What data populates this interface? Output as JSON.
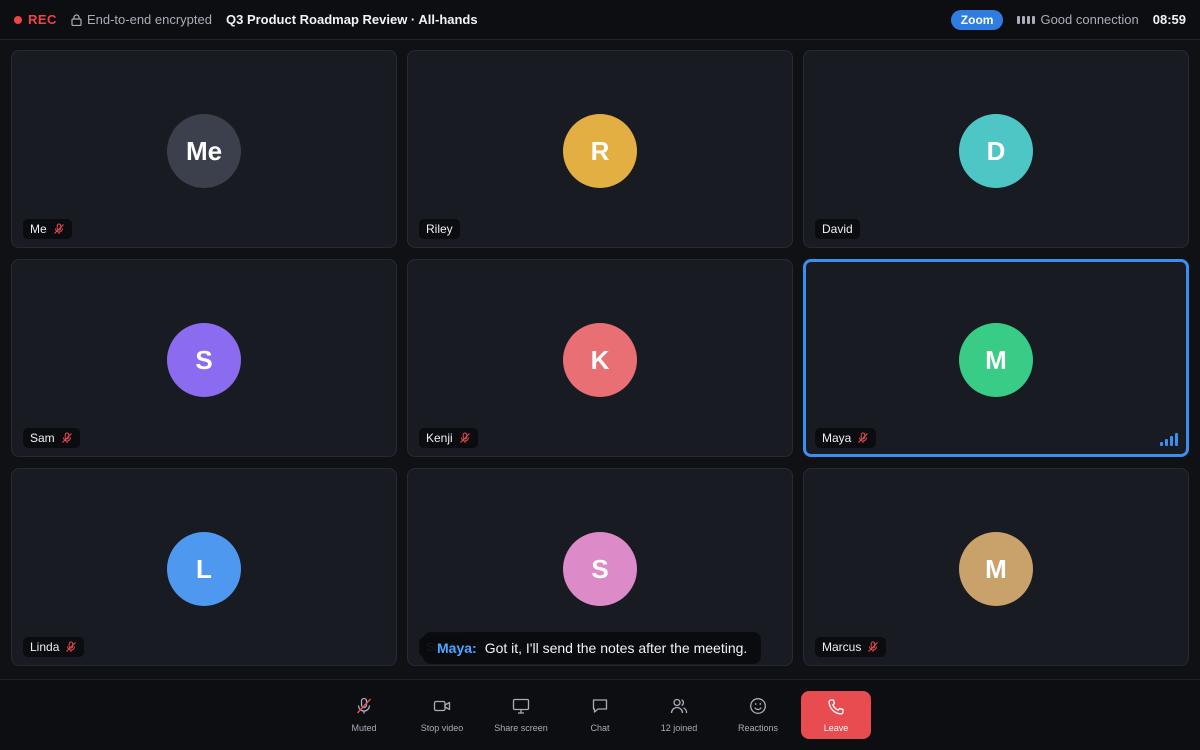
{
  "topbar": {
    "rec_label": "REC",
    "encryption_label": "End-to-end encrypted",
    "meeting_title": "Q3 Product Roadmap Review · All-hands",
    "app_badge": "Zoom",
    "connection_label": "Good connection",
    "clock": "08:59"
  },
  "participants": [
    {
      "initials": "Me",
      "name": "Me",
      "color": "#3b404c",
      "muted": true
    },
    {
      "initials": "R",
      "name": "Riley",
      "color": "#e3ae42",
      "muted": false
    },
    {
      "initials": "D",
      "name": "David",
      "color": "#4fc6c6",
      "muted": false
    },
    {
      "initials": "S",
      "name": "Sam",
      "color": "#8b6cf0",
      "muted": true
    },
    {
      "initials": "K",
      "name": "Kenji",
      "color": "#e86f73",
      "muted": true
    },
    {
      "initials": "M",
      "name": "Maya",
      "color": "#38cc86",
      "muted": true,
      "speaking": true
    },
    {
      "initials": "L",
      "name": "Linda",
      "color": "#4f98f0",
      "muted": true
    },
    {
      "initials": "S",
      "name": "Sarah",
      "color": "#dd8bc8",
      "muted": false
    },
    {
      "initials": "M",
      "name": "Marcus",
      "color": "#c9a26b",
      "muted": true
    }
  ],
  "caption": {
    "speaker": "Maya:",
    "text": "Got it, I'll send the notes after the meeting."
  },
  "controls": {
    "mute_label": "Muted",
    "video_label": "Stop video",
    "share_label": "Share screen",
    "chat_label": "Chat",
    "participants_label": "12 joined",
    "reactions_label": "Reactions",
    "leave_label": "Leave"
  },
  "colors": {
    "accent": "#3b8ff0",
    "rec": "#ef4444",
    "leave": "#e84b50",
    "badge": "#2f7de1"
  }
}
